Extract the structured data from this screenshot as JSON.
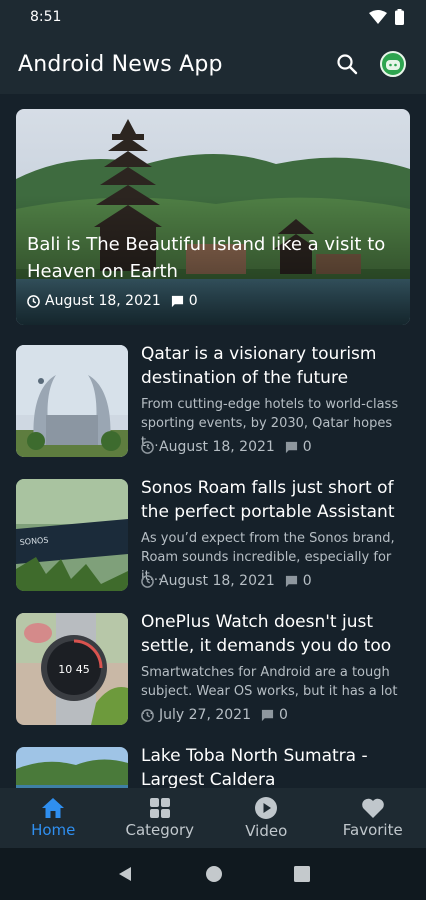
{
  "status_bar": {
    "time": "8:51"
  },
  "app_bar": {
    "title": "Android News App"
  },
  "hero": {
    "title": "Bali is The Beautiful Island like a visit to Heaven on Earth",
    "date": "August 18, 2021",
    "comments": "0"
  },
  "articles": [
    {
      "title": "Qatar is a visionary tourism destination of the future",
      "description": "From cutting-edge hotels to world-class sporting events, by 2030, Qatar hopes t...",
      "date": "August 18, 2021",
      "comments": "0"
    },
    {
      "title": "Sonos Roam falls just short of the perfect portable Assistant",
      "description": "As you’d expect from the Sonos brand, Roam sounds incredible, especially for it...",
      "date": "August 18, 2021",
      "comments": "0"
    },
    {
      "title": "OnePlus Watch doesn't just settle, it demands you do too",
      "description": "Smartwatches for Android are a tough subject. Wear OS works, but it has a lot ...",
      "date": "July 27, 2021",
      "comments": "0"
    },
    {
      "title": "Lake Toba North Sumatra - Largest Caldera",
      "description": "",
      "date": "",
      "comments": ""
    }
  ],
  "bottom_nav": {
    "items": [
      {
        "label": "Home",
        "icon": "home-icon",
        "active": true
      },
      {
        "label": "Category",
        "icon": "grid-icon",
        "active": false
      },
      {
        "label": "Video",
        "icon": "play-circle-icon",
        "active": false
      },
      {
        "label": "Favorite",
        "icon": "heart-icon",
        "active": false
      }
    ]
  },
  "thumb_text": {
    "sonos": "SONOS",
    "watch_time": "10 45"
  },
  "colors": {
    "background": "#16212a",
    "bar": "#1e2a32",
    "accent": "#2f8ff0",
    "muted_text": "#b6bec4"
  }
}
